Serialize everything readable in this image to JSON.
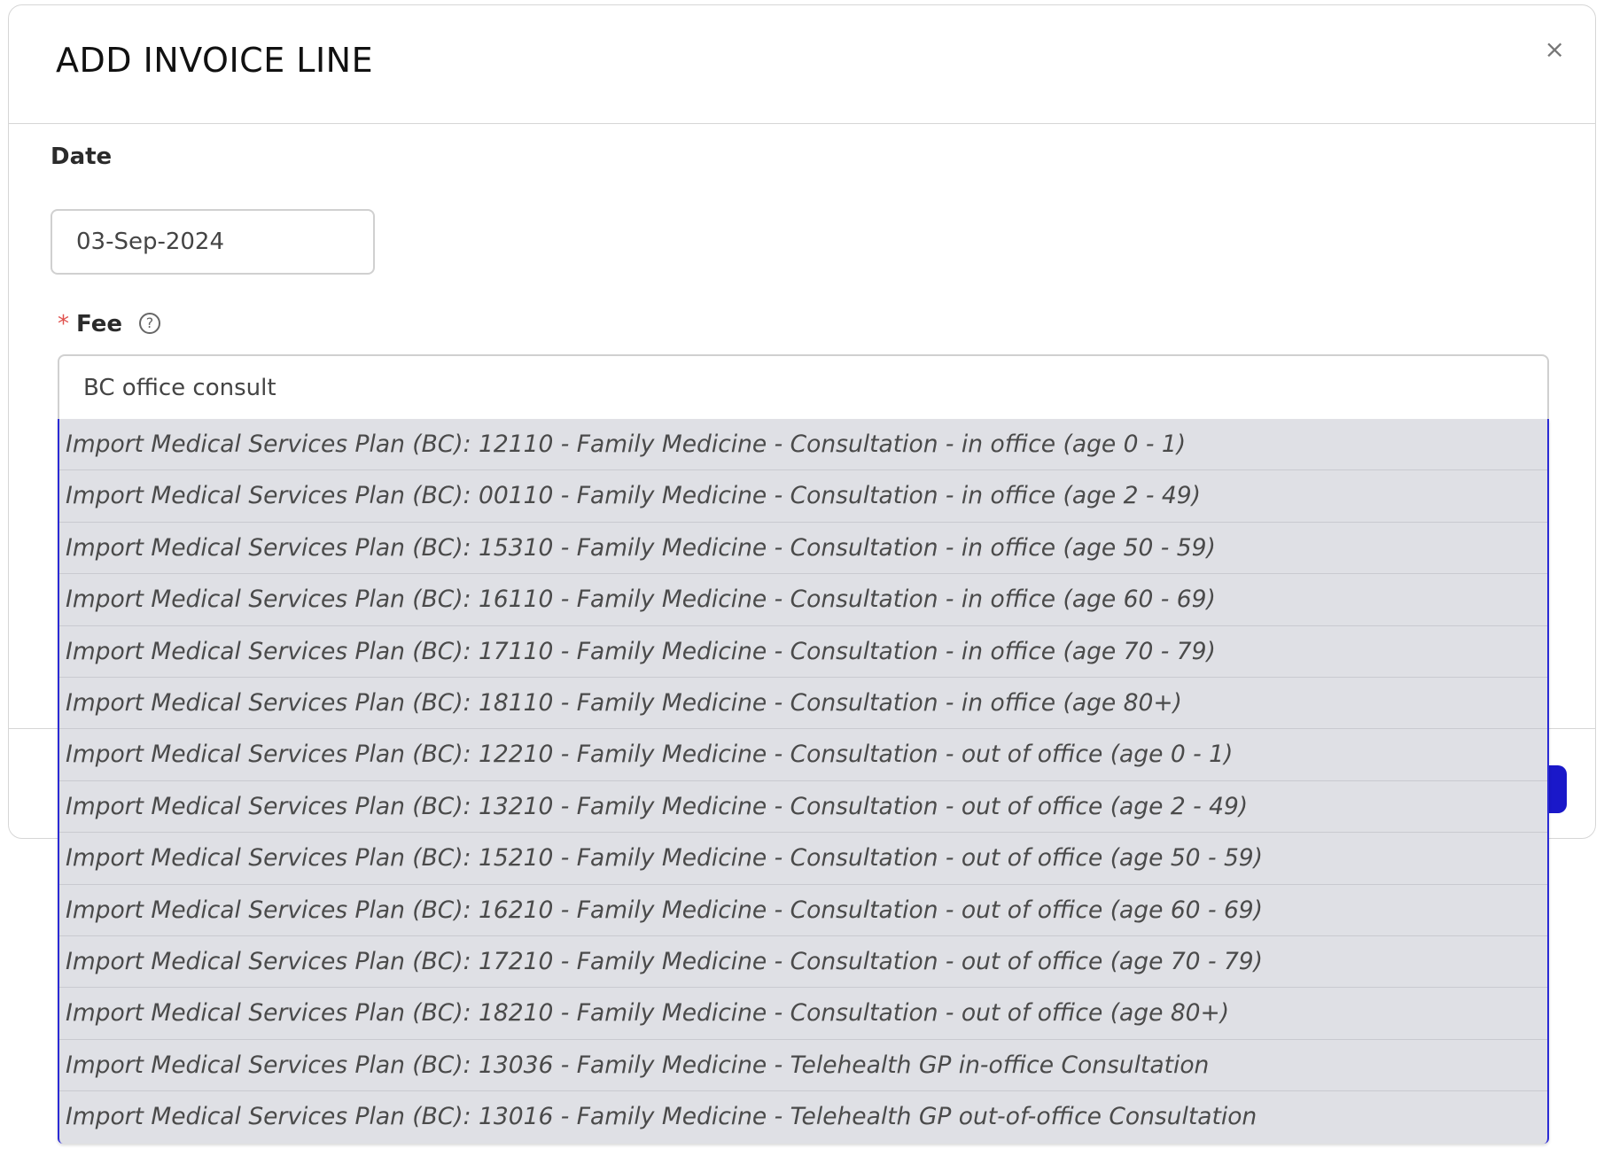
{
  "modal": {
    "title": "ADD INVOICE LINE",
    "close_label": "×"
  },
  "date": {
    "label": "Date",
    "value": "03-Sep-2024"
  },
  "fee": {
    "required_marker": "*",
    "label": "Fee",
    "help_icon": "question-circle-icon",
    "help_glyph": "?",
    "value": "BC office consult"
  },
  "dropdown": {
    "items": [
      "Import Medical Services Plan (BC): 12110 - Family Medicine - Consultation - in office (age 0 - 1)",
      "Import Medical Services Plan (BC): 00110 - Family Medicine - Consultation - in office (age 2 - 49)",
      "Import Medical Services Plan (BC): 15310 - Family Medicine - Consultation - in office (age 50 - 59)",
      "Import Medical Services Plan (BC): 16110 - Family Medicine - Consultation - in office (age 60 - 69)",
      "Import Medical Services Plan (BC): 17110 - Family Medicine - Consultation - in office (age 70 - 79)",
      "Import Medical Services Plan (BC): 18110 - Family Medicine - Consultation - in office (age 80+)",
      "Import Medical Services Plan (BC): 12210 - Family Medicine - Consultation - out of office (age 0 - 1)",
      "Import Medical Services Plan (BC): 13210 - Family Medicine - Consultation - out of office (age 2 - 49)",
      "Import Medical Services Plan (BC): 15210 - Family Medicine - Consultation - out of office (age 50 - 59)",
      "Import Medical Services Plan (BC): 16210 - Family Medicine - Consultation - out of office (age 60 - 69)",
      "Import Medical Services Plan (BC): 17210 - Family Medicine - Consultation - out of office (age 70 - 79)",
      "Import Medical Services Plan (BC): 18210 - Family Medicine - Consultation - out of office (age 80+)",
      "Import Medical Services Plan (BC): 13036 - Family Medicine - Telehealth GP in-office Consultation",
      "Import Medical Services Plan (BC): 13016 - Family Medicine - Telehealth GP out-of-office Consultation"
    ]
  },
  "colors": {
    "primary_button": "#1a18c9",
    "dropdown_border": "#2b2bd4",
    "dropdown_background": "#dfe0e5",
    "required": "#e0524e"
  }
}
